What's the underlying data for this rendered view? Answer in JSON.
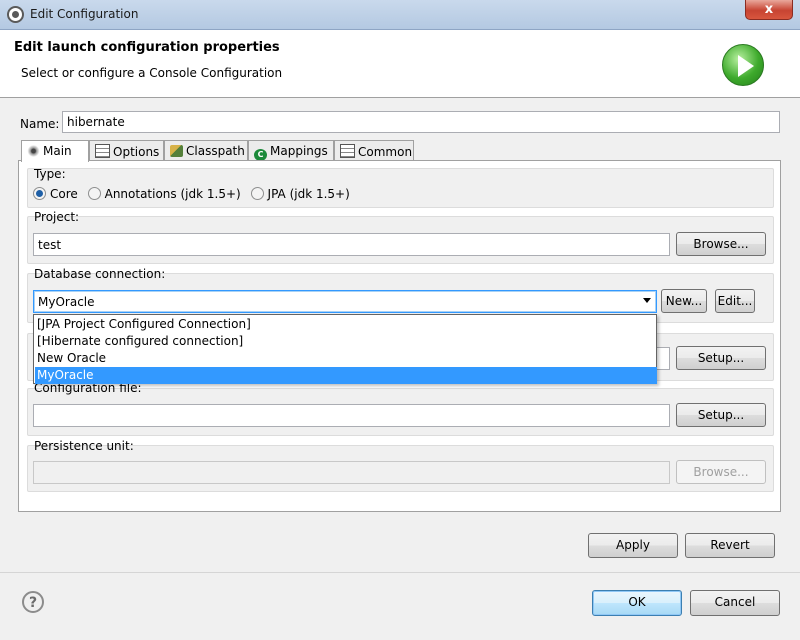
{
  "window": {
    "title": "Edit Configuration",
    "close": "x"
  },
  "header": {
    "title": "Edit launch configuration properties",
    "subtitle": "Select or configure a Console Configuration"
  },
  "name": {
    "label": "Name:",
    "value": "hibernate"
  },
  "tabs": [
    {
      "label": "Main",
      "icon": "main-tab-icon",
      "active": true
    },
    {
      "label": "Options",
      "icon": "table-icon"
    },
    {
      "label": "Classpath",
      "icon": "classpath-icon"
    },
    {
      "label": "Mappings",
      "icon": "mappings-icon",
      "icon_text": "C"
    },
    {
      "label": "Common",
      "icon": "table-icon"
    }
  ],
  "type_group": {
    "label": "Type:",
    "options": [
      {
        "label": "Core",
        "selected": true
      },
      {
        "label": "Annotations (jdk 1.5+)",
        "selected": false
      },
      {
        "label": "JPA (jdk 1.5+)",
        "selected": false
      }
    ]
  },
  "project": {
    "label": "Project:",
    "value": "test",
    "button": "Browse..."
  },
  "db": {
    "label": "Database connection:",
    "value": "MyOracle",
    "new_button": "New...",
    "edit_button": "Edit...",
    "options": [
      "[JPA Project Configured Connection]",
      "[Hibernate configured connection]",
      "New Oracle",
      "MyOracle"
    ],
    "selected_index": 3
  },
  "hidden_row": {
    "button": "Setup..."
  },
  "config_file": {
    "label": "Configuration file:",
    "value": "",
    "button": "Setup..."
  },
  "persistence": {
    "label": "Persistence unit:",
    "value": "",
    "button": "Browse..."
  },
  "actions": {
    "apply": "Apply",
    "revert": "Revert"
  },
  "footer": {
    "help": "?",
    "ok": "OK",
    "cancel": "Cancel"
  }
}
